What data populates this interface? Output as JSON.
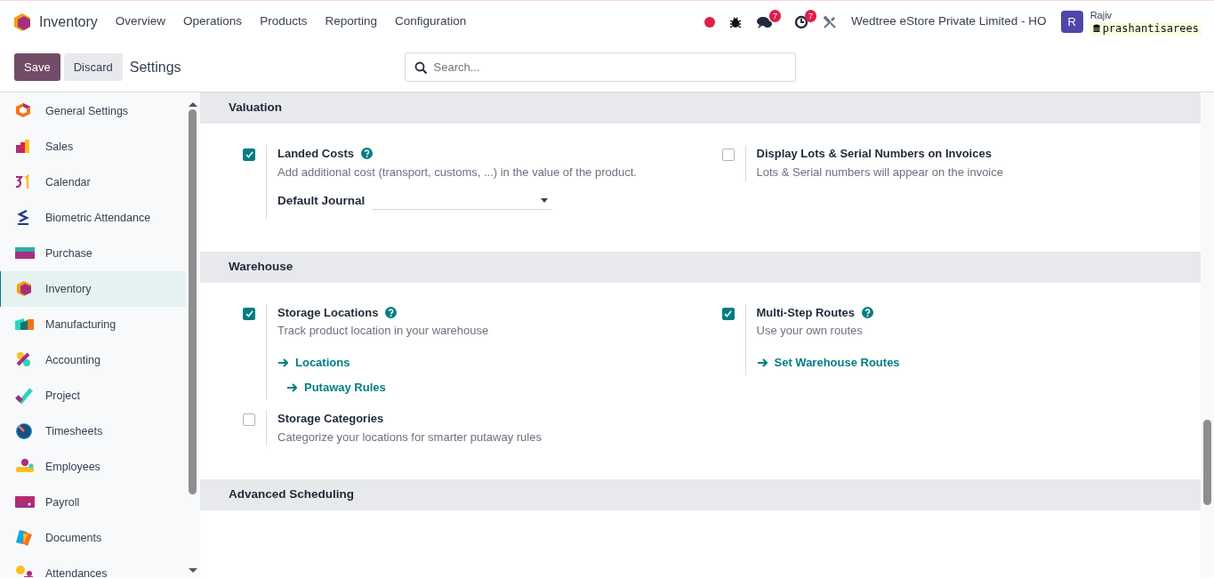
{
  "navbar": {
    "app_name": "Inventory",
    "menu": [
      "Overview",
      "Operations",
      "Products",
      "Reporting",
      "Configuration"
    ],
    "chat_count": "7",
    "activity_count": "7",
    "company": "Wedtree eStore Private Limited - HO",
    "user": {
      "initial": "R",
      "name": "Rajiv",
      "database": "prashantisarees"
    }
  },
  "control_panel": {
    "buttons": [
      "Save",
      "Discard"
    ],
    "title": "Settings",
    "search": {
      "placeholder": "Search..."
    }
  },
  "sidebar": {
    "items": [
      {
        "label": "General Settings",
        "selected": false
      },
      {
        "label": "Sales",
        "selected": false
      },
      {
        "label": "Calendar",
        "selected": false
      },
      {
        "label": "Biometric Attendance",
        "selected": false
      },
      {
        "label": "Purchase",
        "selected": false
      },
      {
        "label": "Inventory",
        "selected": true
      },
      {
        "label": "Manufacturing",
        "selected": false
      },
      {
        "label": "Accounting",
        "selected": false
      },
      {
        "label": "Project",
        "selected": false
      },
      {
        "label": "Timesheets",
        "selected": false
      },
      {
        "label": "Employees",
        "selected": false
      },
      {
        "label": "Payroll",
        "selected": false
      },
      {
        "label": "Documents",
        "selected": false
      },
      {
        "label": "Attendances",
        "selected": false
      }
    ]
  },
  "sections": [
    {
      "title": "Valuation",
      "settings": [
        {
          "title": "Landed Costs",
          "checked": true,
          "help": true,
          "description": "Add additional cost (transport, customs, ...) in the value of the product.",
          "field": {
            "label": "Default Journal"
          }
        },
        {
          "title": "Display Lots & Serial Numbers on Invoices",
          "checked": false,
          "help": false,
          "description": "Lots & Serial numbers will appear on the invoice"
        }
      ]
    },
    {
      "title": "Warehouse",
      "settings": [
        {
          "title": "Storage Locations",
          "checked": true,
          "help": true,
          "description": "Track product location in your warehouse",
          "links": [
            {
              "label": "Locations",
              "children": [
                {
                  "label": "Putaway Rules"
                }
              ]
            }
          ]
        },
        {
          "title": "Multi-Step Routes",
          "checked": true,
          "help": true,
          "description": "Use your own routes",
          "links": [
            {
              "label": "Set Warehouse Routes"
            }
          ]
        },
        {
          "title": "Storage Categories",
          "checked": false,
          "help": false,
          "description": "Categorize your locations for smarter putaway rules"
        }
      ]
    },
    {
      "title": "Advanced Scheduling"
    }
  ]
}
